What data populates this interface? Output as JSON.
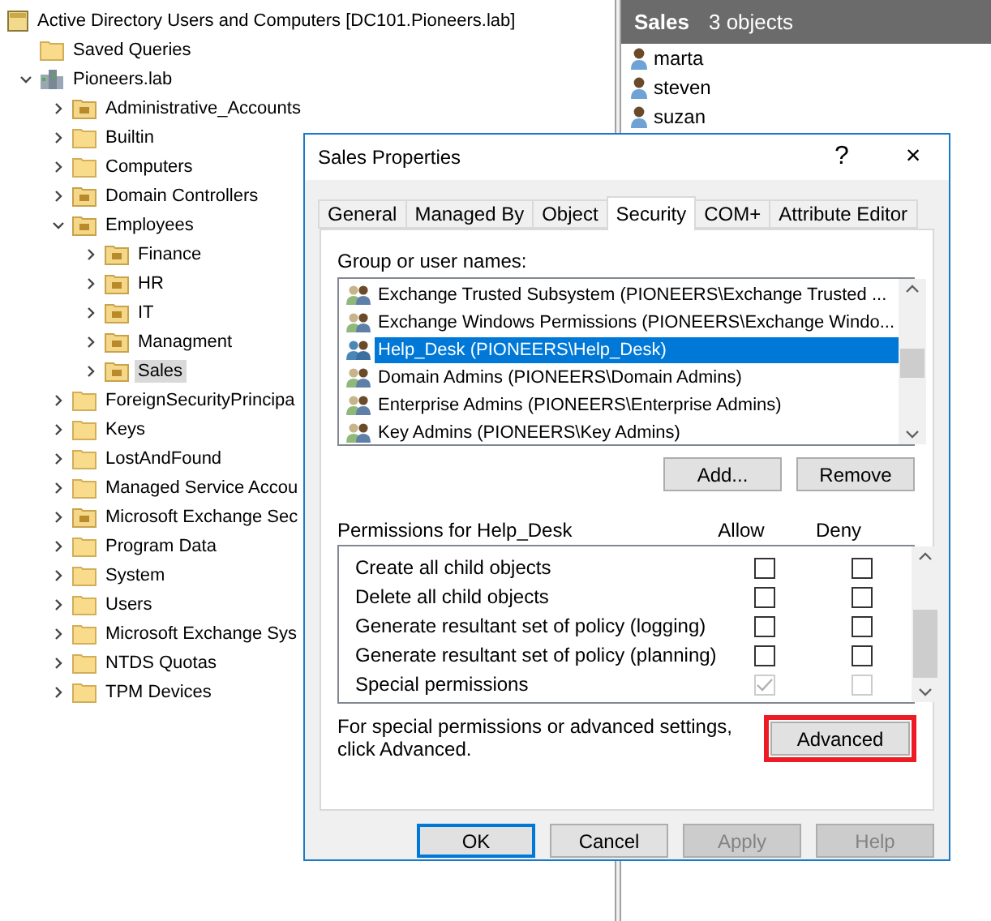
{
  "tree": [
    {
      "label": "Active Directory Users and Computers [DC101.Pioneers.lab]",
      "kind": "console",
      "selected": false,
      "children": [
        {
          "label": "Saved Queries",
          "kind": "folder",
          "selected": false
        },
        {
          "label": "Pioneers.lab",
          "kind": "domain",
          "expanded": true,
          "selected": false,
          "children": [
            {
              "label": "Administrative_Accounts",
              "kind": "ou",
              "expanded": false,
              "selected": false
            },
            {
              "label": "Builtin",
              "kind": "folder",
              "expanded": false,
              "selected": false
            },
            {
              "label": "Computers",
              "kind": "folder",
              "expanded": false,
              "selected": false
            },
            {
              "label": "Domain Controllers",
              "kind": "ou",
              "expanded": false,
              "selected": false
            },
            {
              "label": "Employees",
              "kind": "ou",
              "expanded": true,
              "selected": false,
              "children": [
                {
                  "label": "Finance",
                  "kind": "ou",
                  "expanded": false,
                  "selected": false
                },
                {
                  "label": "HR",
                  "kind": "ou",
                  "expanded": false,
                  "selected": false
                },
                {
                  "label": "IT",
                  "kind": "ou",
                  "expanded": false,
                  "selected": false
                },
                {
                  "label": "Managment",
                  "kind": "ou",
                  "expanded": false,
                  "selected": false
                },
                {
                  "label": "Sales",
                  "kind": "ou",
                  "expanded": false,
                  "selected": true
                }
              ]
            },
            {
              "label": "ForeignSecurityPrincipa",
              "kind": "folder",
              "expanded": false,
              "selected": false
            },
            {
              "label": "Keys",
              "kind": "folder",
              "expanded": false,
              "selected": false
            },
            {
              "label": "LostAndFound",
              "kind": "folder",
              "expanded": false,
              "selected": false
            },
            {
              "label": "Managed Service Accou",
              "kind": "folder",
              "expanded": false,
              "selected": false
            },
            {
              "label": "Microsoft Exchange Sec",
              "kind": "ou",
              "expanded": false,
              "selected": false
            },
            {
              "label": "Program Data",
              "kind": "folder",
              "expanded": false,
              "selected": false
            },
            {
              "label": "System",
              "kind": "folder",
              "expanded": false,
              "selected": false
            },
            {
              "label": "Users",
              "kind": "folder",
              "expanded": false,
              "selected": false
            },
            {
              "label": "Microsoft Exchange Sys",
              "kind": "folder",
              "expanded": false,
              "selected": false
            },
            {
              "label": "NTDS Quotas",
              "kind": "folder",
              "expanded": false,
              "selected": false
            },
            {
              "label": "TPM Devices",
              "kind": "folder",
              "expanded": false,
              "selected": false
            }
          ]
        }
      ]
    }
  ],
  "details": {
    "title": "Sales",
    "count": "3 objects",
    "items": [
      "marta",
      "steven",
      "suzan"
    ]
  },
  "dialog": {
    "title": "Sales Properties",
    "help": "?",
    "close": "×",
    "tabs": [
      {
        "label": "General",
        "selected": false
      },
      {
        "label": "Managed By",
        "selected": false
      },
      {
        "label": "Object",
        "selected": false
      },
      {
        "label": "Security",
        "selected": true
      },
      {
        "label": "COM+",
        "selected": false
      },
      {
        "label": "Attribute Editor",
        "selected": false
      }
    ],
    "groups_label": "Group or user names:",
    "groups": [
      {
        "name": "Exchange Trusted Subsystem (PIONEERS\\Exchange Trusted ...",
        "selected": false
      },
      {
        "name": "Exchange Windows Permissions (PIONEERS\\Exchange Windo...",
        "selected": false
      },
      {
        "name": "Help_Desk (PIONEERS\\Help_Desk)",
        "selected": true
      },
      {
        "name": "Domain Admins (PIONEERS\\Domain Admins)",
        "selected": false
      },
      {
        "name": "Enterprise Admins (PIONEERS\\Enterprise Admins)",
        "selected": false
      },
      {
        "name": "Key Admins (PIONEERS\\Key Admins)",
        "selected": false
      }
    ],
    "group_buttons": [
      {
        "label": "Add...",
        "disabled": false
      },
      {
        "label": "Remove",
        "disabled": false
      }
    ],
    "permissions": {
      "title": "Permissions for Help_Desk",
      "allow_header": "Allow",
      "deny_header": "Deny",
      "rows": [
        {
          "label": "Create all child objects",
          "allow": false,
          "deny": false,
          "disabled": false
        },
        {
          "label": "Delete all child objects",
          "allow": false,
          "deny": false,
          "disabled": false
        },
        {
          "label": "Generate resultant set of policy (logging)",
          "allow": false,
          "deny": false,
          "disabled": false
        },
        {
          "label": "Generate resultant set of policy (planning)",
          "allow": false,
          "deny": false,
          "disabled": false
        },
        {
          "label": "Special permissions",
          "allow": true,
          "deny": false,
          "disabled": true
        }
      ]
    },
    "note": "For special permissions or advanced settings, click Advanced.",
    "advanced": {
      "label": "Advanced",
      "highlighted": true
    },
    "buttons": [
      {
        "label": "OK",
        "default": true,
        "disabled": false
      },
      {
        "label": "Cancel",
        "default": false,
        "disabled": false
      },
      {
        "label": "Apply",
        "default": false,
        "disabled": true
      },
      {
        "label": "Help",
        "default": false,
        "disabled": true
      }
    ]
  }
}
